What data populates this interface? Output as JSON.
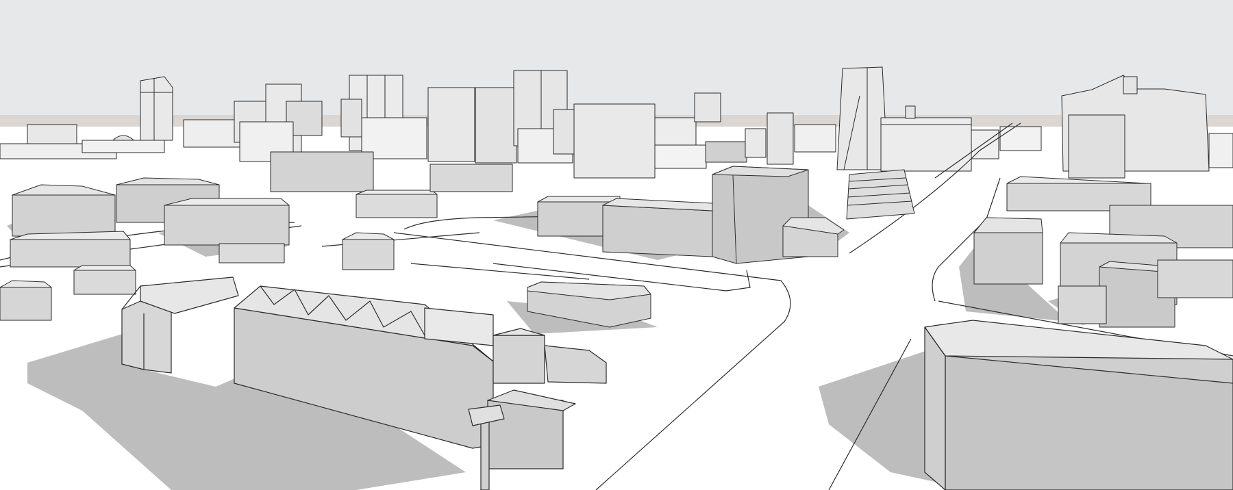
{
  "viewport": {
    "kind": "3d-model-viewport",
    "style": "monochrome-sketch-with-shadows"
  },
  "colors": {
    "sky": "#e6e8e9",
    "horizon_ground": "#d9d6d3",
    "ground": "#ffffff",
    "face_light": "#ececec",
    "face_mid": "#c9c9c9",
    "face_dark": "#a9a9a9",
    "roof": "#dadada",
    "shadow": "#bdbdbd",
    "edge": "#2a2a2a"
  }
}
